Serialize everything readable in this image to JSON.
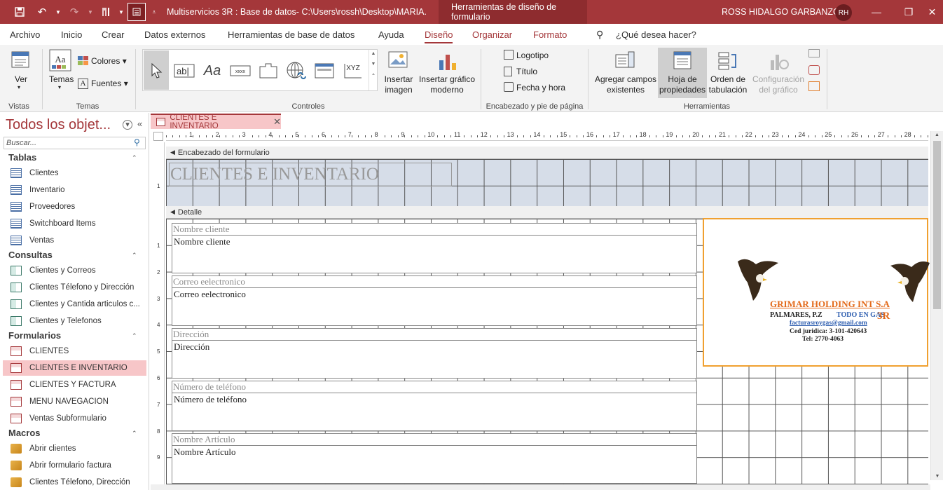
{
  "titlebar": {
    "document_title": "Multiservicios 3R : Base de datos- C:\\Users\\rossh\\Desktop\\MARIA...",
    "context_tab": "Herramientas de diseño de formulario",
    "user_name": "ROSS HIDALGO  GARBANZO",
    "user_initials": "RH"
  },
  "menu": {
    "tabs": [
      "Archivo",
      "Inicio",
      "Crear",
      "Datos externos",
      "Herramientas de base de datos",
      "Ayuda",
      "Diseño",
      "Organizar",
      "Formato"
    ],
    "active_tab": "Diseño",
    "search_placeholder": "¿Qué desea hacer?"
  },
  "ribbon": {
    "vistas": {
      "ver": "Ver",
      "group": "Vistas"
    },
    "temas": {
      "temas": "Temas",
      "colores": "Colores",
      "fuentes": "Fuentes",
      "group": "Temas"
    },
    "controles": {
      "group": "Controles",
      "insertar_imagen": "Insertar imagen",
      "insertar_grafico": "Insertar gráfico moderno"
    },
    "encabezado": {
      "logotipo": "Logotipo",
      "titulo": "Título",
      "fecha_hora": "Fecha y hora",
      "group": "Encabezado y pie de página"
    },
    "herramientas": {
      "agregar_campos": "Agregar campos existentes",
      "hoja_propiedades": "Hoja de propiedades",
      "orden_tabulacion": "Orden de tabulación",
      "configuracion_grafico": "Configuración del gráfico",
      "group": "Herramientas"
    }
  },
  "nav": {
    "title": "Todos los objet...",
    "search_placeholder": "Buscar...",
    "sections": [
      {
        "name": "Tablas",
        "icon": "table-icon",
        "items": [
          "Clientes",
          "Inventario",
          "Proveedores",
          "Switchboard Items",
          "Ventas"
        ]
      },
      {
        "name": "Consultas",
        "icon": "query-icon",
        "items": [
          "Clientes  y Correos",
          "Clientes Télefono y Dirección",
          "Clientes y Cantida articulos c...",
          "Clientes y Telefonos"
        ]
      },
      {
        "name": "Formularios",
        "icon": "form-icon",
        "items": [
          "CLIENTES",
          "CLIENTES E INVENTARIO",
          "CLIENTES Y FACTURA",
          "MENÚ NAVEGACIÓN",
          "Ventas Subformulario"
        ]
      },
      {
        "name": "Macros",
        "icon": "macro-icon",
        "items": [
          "Abrir clientes",
          "Abrir formulario factura",
          "Clientes Télefono, Dirección"
        ]
      }
    ],
    "selected_item": "CLIENTES E INVENTARIO"
  },
  "document": {
    "tab_label": "CLIENTES E INVENTARIO",
    "header_section": "Encabezado del formulario",
    "detail_section": "Detalle",
    "form_title": "CLIENTES E INVENTARIO",
    "fields": [
      {
        "label": "Nombre cliente",
        "control": "Nombre cliente"
      },
      {
        "label": "Correo eelectronico",
        "control": "Correo eelectronico"
      },
      {
        "label": "Dirección",
        "control": "Dirección"
      },
      {
        "label": "Número de teléfono",
        "control": "Número de teléfono"
      },
      {
        "label": "Nombre Artículo",
        "control": "Nombre Artículo"
      }
    ],
    "ruler_numbers": [
      "1",
      "2",
      "3",
      "4",
      "5",
      "6",
      "7",
      "8",
      "9",
      "10",
      "11",
      "12",
      "13",
      "14",
      "15",
      "16",
      "17",
      "18",
      "19",
      "20",
      "21",
      "22",
      "23",
      "24",
      "25",
      "26",
      "27",
      "28"
    ],
    "vruler_header": [
      "1"
    ],
    "vruler_detail": [
      "1",
      "2",
      "3",
      "4",
      "5",
      "6",
      "7",
      "8",
      "9"
    ],
    "logo": {
      "company": "GRIMAR HOLDING INT S.A",
      "location": "PALMARES, P.Z",
      "tagline": "TODO EN GAS",
      "brand": "3R",
      "email": "facturasroygas@gmail.com",
      "ced": "Ced juridica: 3-101-420643",
      "tel": "Tel: 2770-4063"
    }
  },
  "colors": {
    "accent": "#a4373a",
    "selection": "#f7c6c8",
    "header_band": "#d6dde8",
    "logo_border": "#f0a030"
  }
}
